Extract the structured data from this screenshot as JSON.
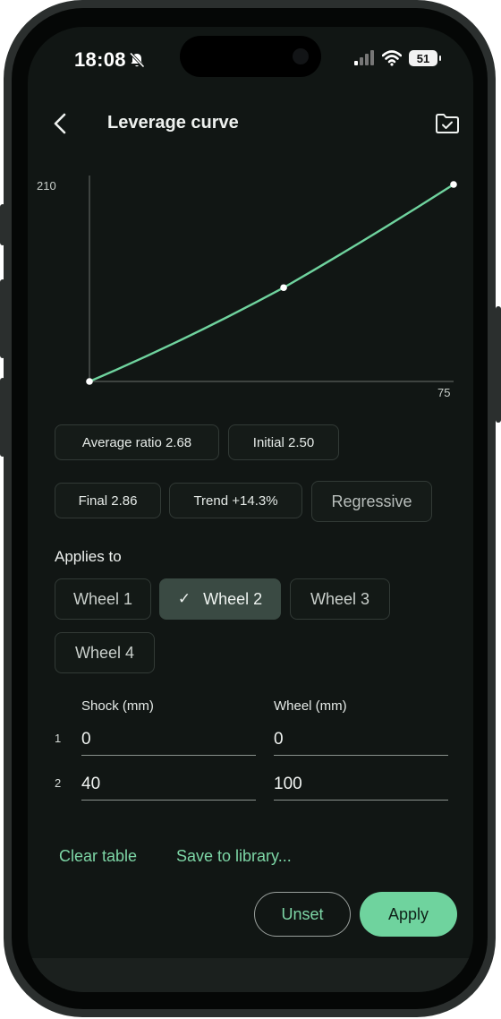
{
  "status": {
    "time": "18:08",
    "battery": "51"
  },
  "header": {
    "title": "Leverage curve"
  },
  "chart_data": {
    "type": "line",
    "title": "",
    "xlabel": "",
    "ylabel": "",
    "x": [
      0,
      40,
      75
    ],
    "y": [
      0,
      100,
      210
    ],
    "xlim": [
      0,
      75
    ],
    "ylim": [
      0,
      210
    ],
    "y_tick_label": "210",
    "x_tick_label": "75",
    "grid": false,
    "line_color": "#6fd39e",
    "point_color": "#ffffff"
  },
  "stats": {
    "average": "Average ratio 2.68",
    "initial": "Initial 2.50",
    "final": "Final 2.86",
    "trend": "Trend +14.3%",
    "type": "Regressive"
  },
  "applies": {
    "label": "Applies to",
    "wheels": [
      "Wheel 1",
      "Wheel 2",
      "Wheel 3",
      "Wheel 4"
    ],
    "selected": "Wheel 2",
    "check": "✓"
  },
  "table": {
    "shock_header": "Shock (mm)",
    "wheel_header": "Wheel (mm)",
    "rows": [
      {
        "num": "1",
        "shock": "0",
        "wheel": "0"
      },
      {
        "num": "2",
        "shock": "40",
        "wheel": "100"
      }
    ]
  },
  "actions": {
    "clear": "Clear table",
    "save": "Save to library...",
    "unset": "Unset",
    "apply": "Apply"
  },
  "colors": {
    "accent": "#6fd39e",
    "background": "#111614"
  }
}
